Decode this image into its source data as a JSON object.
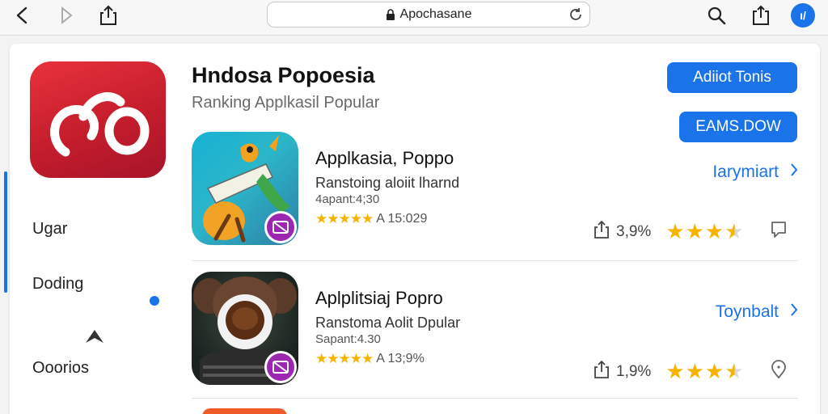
{
  "browser": {
    "url": "Apochasane",
    "profile_initial": "ı/"
  },
  "sidebar": {
    "items": [
      {
        "label": "Ugar"
      },
      {
        "label": "Doding"
      },
      {
        "label": "Ooorios"
      }
    ]
  },
  "header": {
    "title": "Hndosa Popoesia",
    "subtitle": "Ranking Applkasil Popular",
    "primary_button": "Adiiot Tonis",
    "secondary_button": "EAMS.DOW"
  },
  "apps": [
    {
      "name": "Applkasia, Poppo",
      "description": "Ranstoing aloiit lharnd",
      "meta": "4apant:4;30",
      "rating_text": "A 15:029",
      "action_label": "Iarymiart",
      "stat": "3,9%",
      "stars_value": 3.5
    },
    {
      "name": "Aplplitsiaj Popro",
      "description": "Ranstoma Aolit Dpular",
      "meta": "Sapant:4.30",
      "rating_text": "A 13;9%",
      "action_label": "Toynbalt",
      "stat": "1,9%",
      "stars_value": 3.5
    }
  ],
  "colors": {
    "accent": "#1a73e8",
    "brand_red": "#d62533",
    "star": "#f5b400",
    "badge": "#9c27b0"
  }
}
